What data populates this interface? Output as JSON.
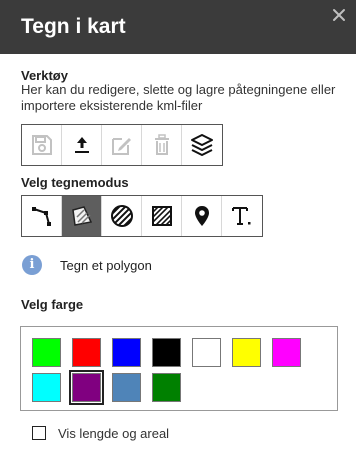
{
  "header": {
    "title": "Tegn i kart",
    "close_icon": "close-icon"
  },
  "tools": {
    "title": "Verktøy",
    "description": "Her kan du redigere, slette og lagre påtegningene eller importere eksisterende kml-filer",
    "items": [
      {
        "icon": "save-icon",
        "enabled": false
      },
      {
        "icon": "upload-icon",
        "enabled": true
      },
      {
        "icon": "edit-icon",
        "enabled": false
      },
      {
        "icon": "trash-icon",
        "enabled": false
      },
      {
        "icon": "layers-icon",
        "enabled": true
      }
    ]
  },
  "modes": {
    "title": "Velg tegnemodus",
    "selected": "polygon",
    "items": [
      {
        "icon": "line-icon"
      },
      {
        "icon": "polygon-icon"
      },
      {
        "icon": "circle-icon"
      },
      {
        "icon": "rectangle-icon"
      },
      {
        "icon": "point-marker-icon"
      },
      {
        "icon": "text-icon"
      }
    ]
  },
  "info": {
    "icon": "info-icon",
    "text": "Tegn et polygon"
  },
  "colors": {
    "title": "Velg farge",
    "selected": "#800080",
    "swatches": [
      "#00ff00",
      "#ff0000",
      "#0000ff",
      "#000000",
      "#ffffff",
      "#ffff00",
      "#ff00ff",
      "#00ffff",
      "#800080",
      "#4f84b8",
      "#008000"
    ]
  },
  "measure": {
    "label": "Vis lengde og areal",
    "checked": false
  }
}
